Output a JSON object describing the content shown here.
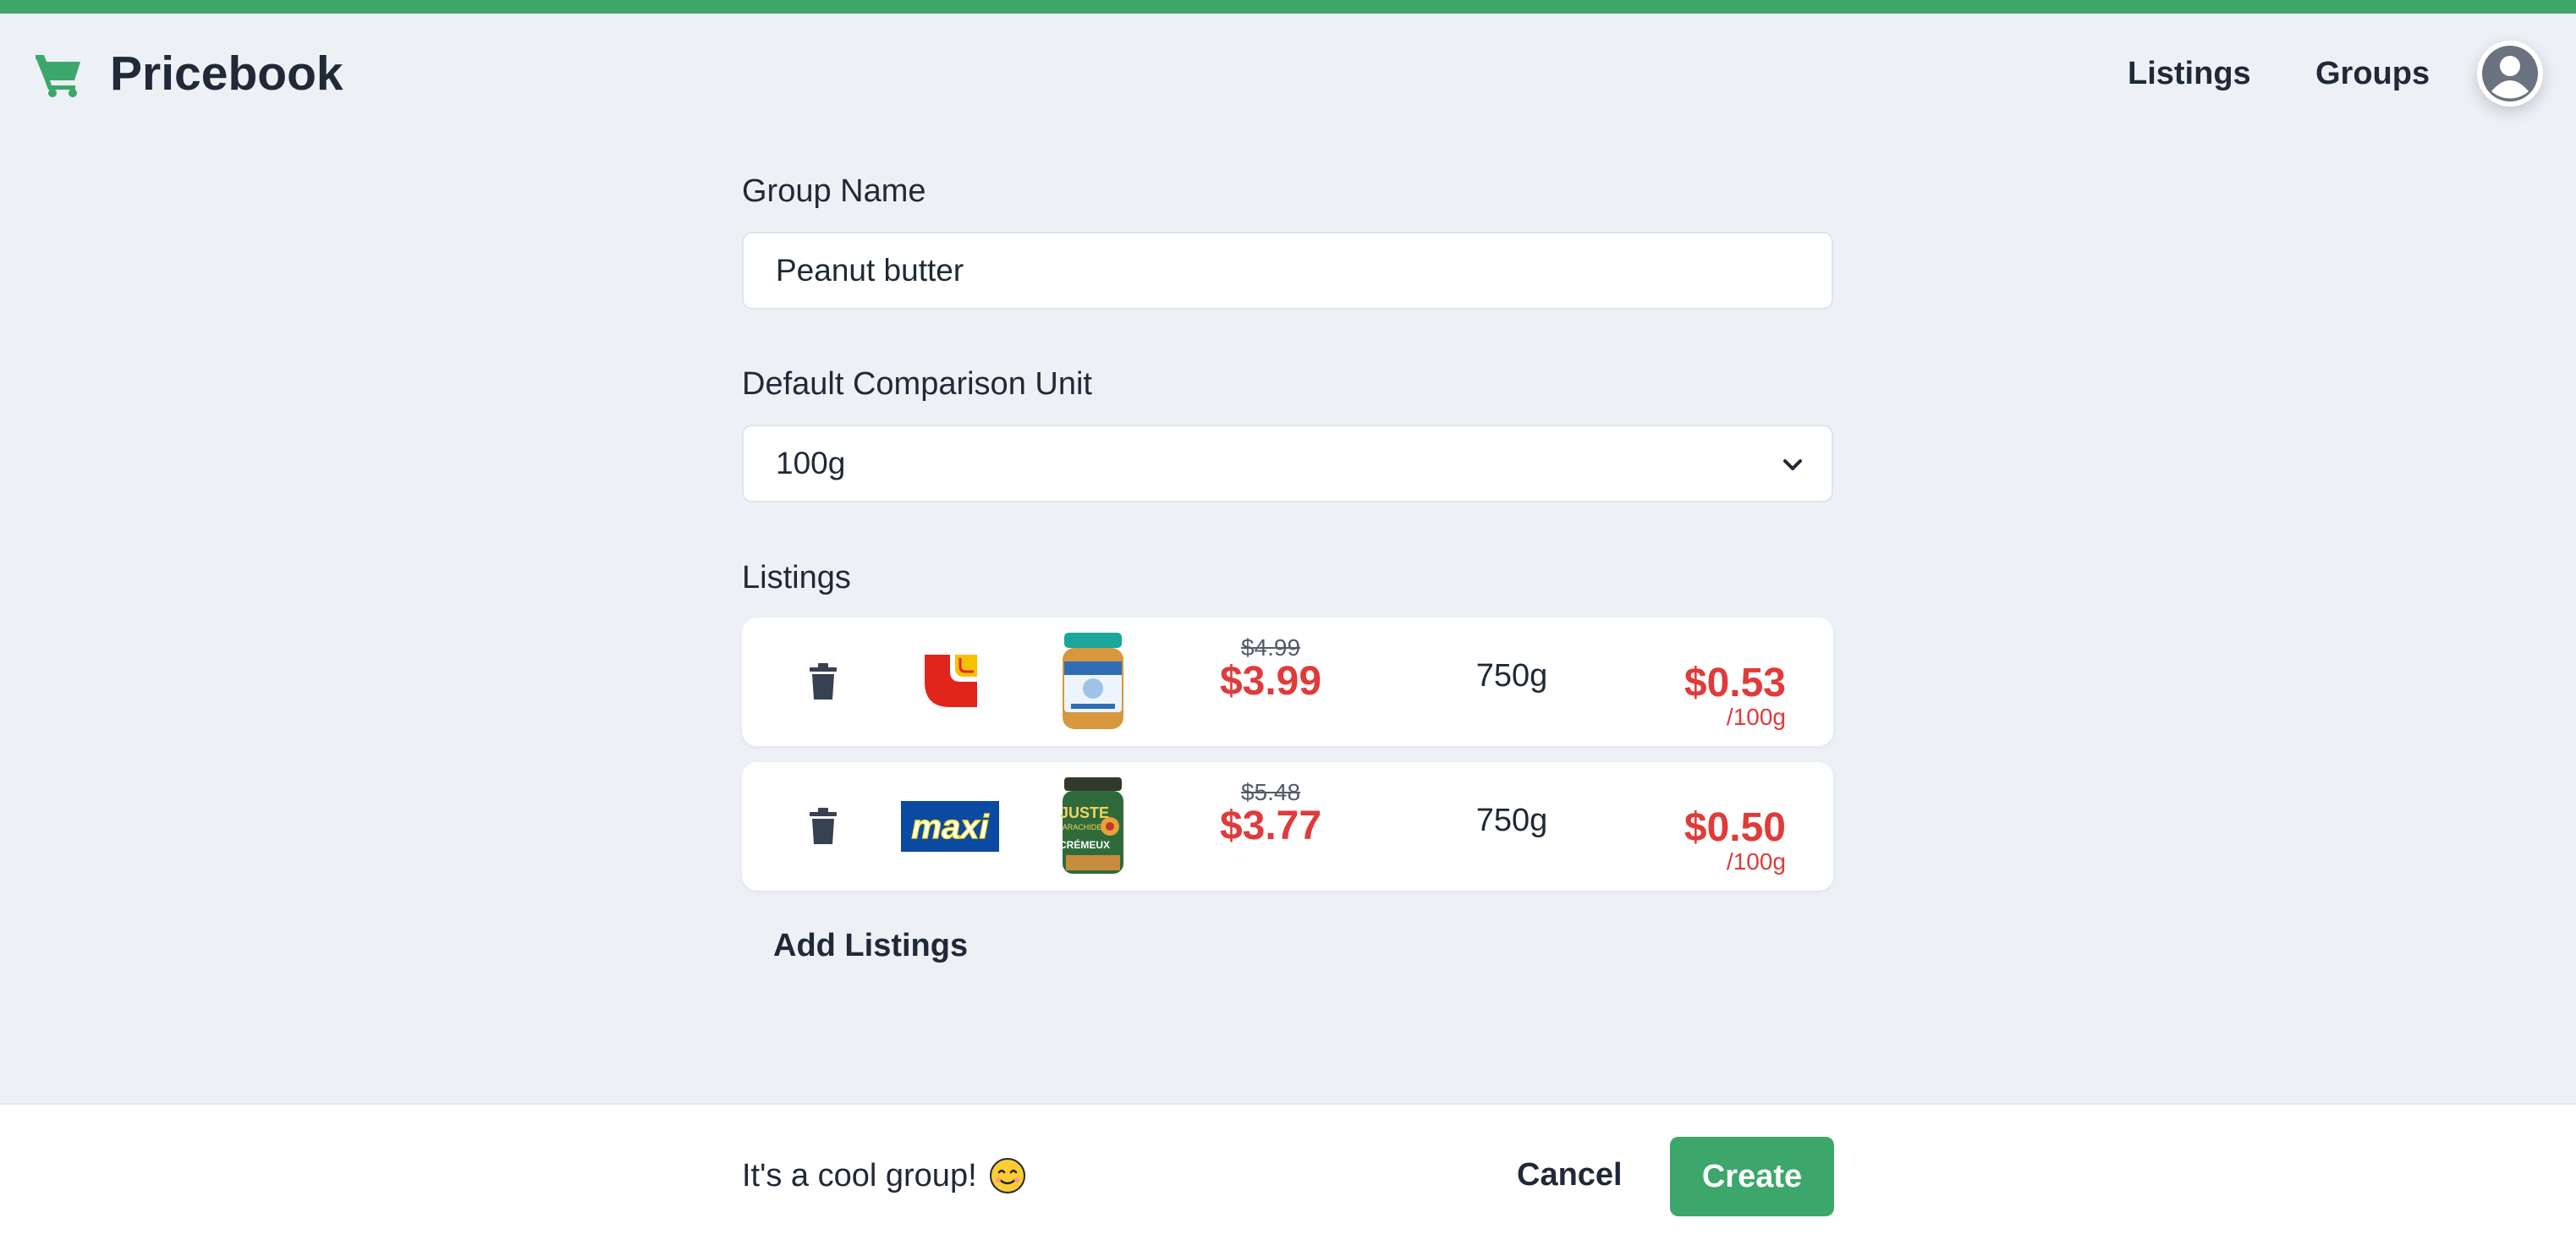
{
  "header": {
    "brand": "Pricebook",
    "brand_icon": "shopping-cart-icon",
    "nav": {
      "listings": "Listings",
      "groups": "Groups"
    },
    "avatar_icon": "user-avatar-icon",
    "accent_color": "#3da66b"
  },
  "form": {
    "group_name_label": "Group Name",
    "group_name_value": "Peanut butter",
    "unit_label": "Default Comparison Unit",
    "unit_value": "100g",
    "listings_label": "Listings",
    "listings": [
      {
        "store": "metro",
        "old_price": "$4.99",
        "price": "$3.99",
        "size": "750g",
        "unit_price": "$0.53",
        "unit_per": "/100g"
      },
      {
        "store": "maxi",
        "store_logo_text": "maxi",
        "product_label_text": "JUSTE ARACHIDES CRÉMEUX",
        "old_price": "$5.48",
        "price": "$3.77",
        "size": "750g",
        "unit_price": "$0.50",
        "unit_per": "/100g"
      }
    ],
    "add_listings": "Add Listings"
  },
  "footer": {
    "message": "It's a cool group!",
    "emoji_icon": "smiling-face-icon",
    "cancel": "Cancel",
    "create": "Create"
  }
}
